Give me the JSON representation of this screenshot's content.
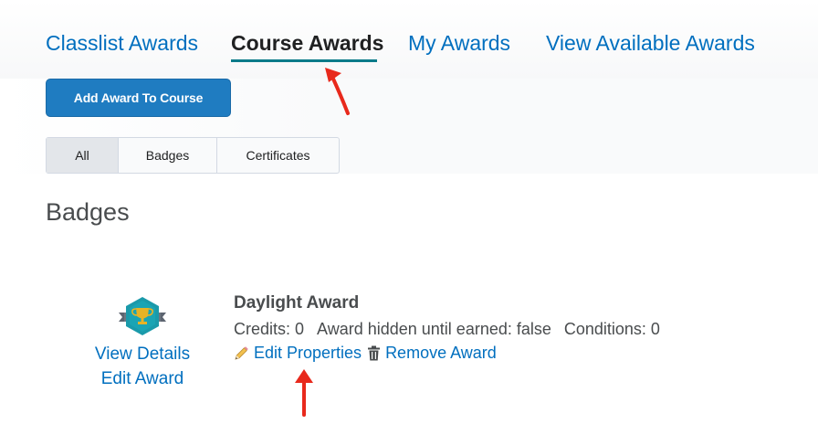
{
  "tabs": {
    "classlist": "Classlist Awards",
    "course": "Course Awards",
    "my": "My Awards",
    "available": "View Available Awards"
  },
  "actions": {
    "add_award": "Add Award To Course"
  },
  "filters": {
    "all": "All",
    "badges": "Badges",
    "certificates": "Certificates"
  },
  "section": {
    "title": "Badges"
  },
  "award": {
    "name": "Daylight Award",
    "credits": "Credits: 0",
    "hidden": "Award hidden until earned: false",
    "conditions": "Conditions: 0",
    "icon": "trophy-badge-icon",
    "view_details": "View Details",
    "edit_award": "Edit Award",
    "edit_properties": "Edit Properties",
    "remove_award": "Remove Award"
  },
  "colors": {
    "link": "#006fbf",
    "primary_button": "#1f7cc1",
    "tab_underline": "#0b7b8a",
    "badge_teal": "#1a9aaa",
    "annotation_arrow": "#e8291c"
  }
}
